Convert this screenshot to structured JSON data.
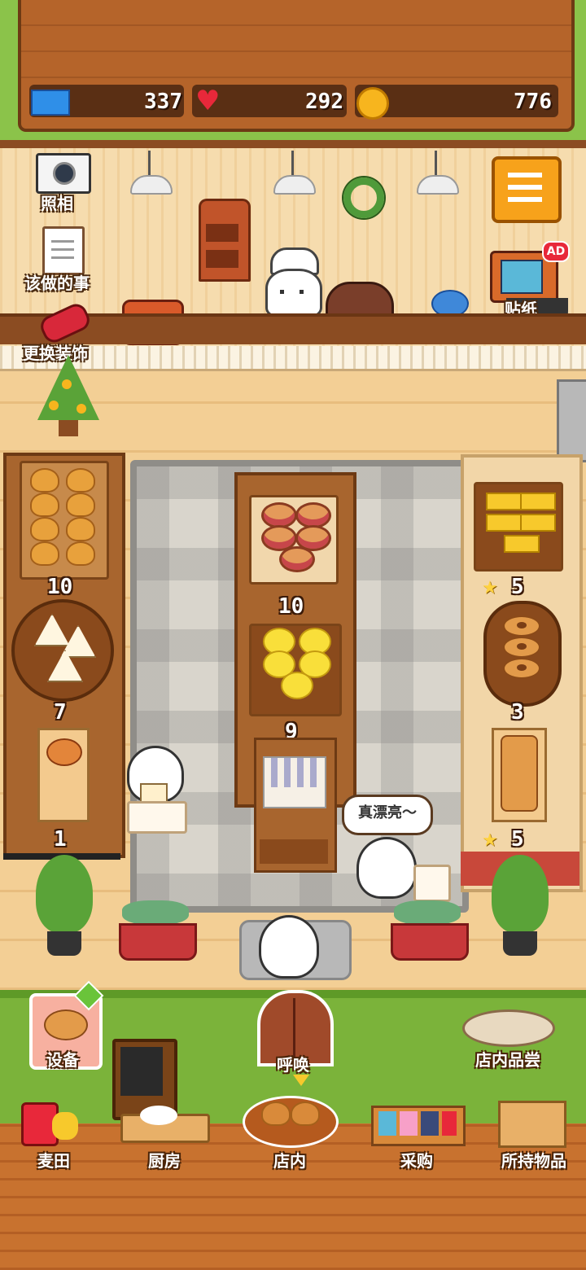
{
  "stats": {
    "tickets": "337",
    "hearts": "292",
    "coins": "776"
  },
  "top_actions": {
    "photo_label": "照相",
    "todo_label": "该做的事",
    "decor_label": "更换装饰",
    "sticker_label": "贴纸",
    "ad_badge": "AD"
  },
  "shelves": {
    "left_top_count": "10",
    "left_mid_count": "7",
    "left_bottom_count": "1",
    "center_mid_count": "10",
    "center_bottom_count": "9",
    "right_top_count": "5",
    "right_mid_count": "3",
    "right_bottom_count": "5"
  },
  "speech": "真漂亮～",
  "bottom_actions": {
    "equipment_label": "设备",
    "call_label": "呼唤",
    "tasting_label": "店内品尝"
  },
  "nav": [
    {
      "label": "麦田"
    },
    {
      "label": "厨房"
    },
    {
      "label": "店内"
    },
    {
      "label": "采购"
    },
    {
      "label": "所持物品"
    }
  ],
  "colors": {
    "wood": "#b5642a",
    "grass": "#7bb33a",
    "accent_orange": "#f7a21b"
  }
}
